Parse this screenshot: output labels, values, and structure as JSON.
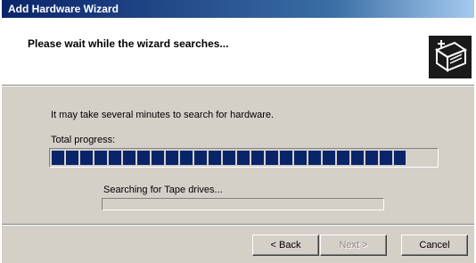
{
  "window": {
    "title": "Add Hardware Wizard"
  },
  "header": {
    "title": "Please wait while the wizard searches...",
    "icon": "hardware-wizard-icon"
  },
  "body": {
    "info_text": "It may take several minutes to search for hardware.",
    "progress_label": "Total progress:",
    "total_progress_fraction": 0.92,
    "search_status": "Searching for Tape drives...",
    "search_progress_fraction": 0.0
  },
  "buttons": {
    "back_label": "< Back",
    "next_label": "Next >",
    "cancel_label": "Cancel"
  },
  "colors": {
    "progress_fill": "#0a246a",
    "dialog_background": "#d4d0c8",
    "titlebar_start": "#0a246a",
    "titlebar_end": "#a6caf0"
  }
}
